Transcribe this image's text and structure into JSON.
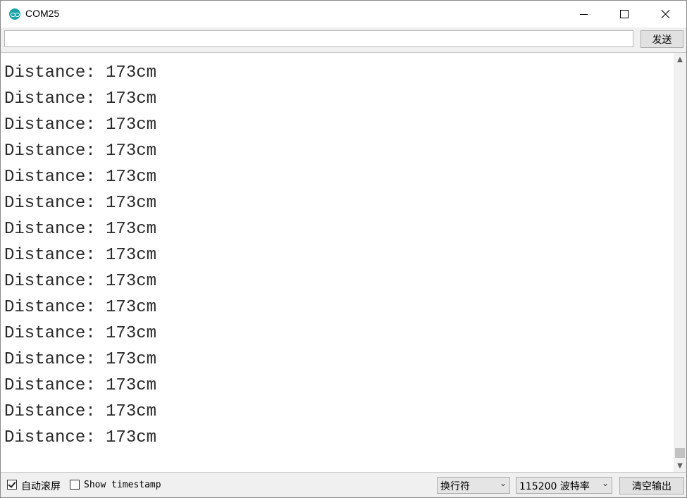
{
  "window": {
    "title": "COM25"
  },
  "toolbar": {
    "send_label": "发送",
    "input_value": ""
  },
  "output": {
    "lines": [
      "Distance: 173cm",
      "Distance: 173cm",
      "Distance: 173cm",
      "Distance: 173cm",
      "Distance: 173cm",
      "Distance: 173cm",
      "Distance: 173cm",
      "Distance: 173cm",
      "Distance: 173cm",
      "Distance: 173cm",
      "Distance: 173cm",
      "Distance: 173cm",
      "Distance: 173cm",
      "Distance: 173cm",
      "Distance: 173cm"
    ]
  },
  "bottom": {
    "autoscroll_label": "自动滚屏",
    "autoscroll_checked": true,
    "timestamp_label": "Show timestamp",
    "timestamp_checked": false,
    "line_ending": "换行符",
    "baud_rate": "115200 波特率",
    "clear_label": "清空输出"
  },
  "icons": {
    "app": "arduino-icon",
    "minimize": "minimize-icon",
    "maximize": "maximize-icon",
    "close": "close-icon"
  },
  "colors": {
    "app_icon": "#1aa2a6"
  }
}
